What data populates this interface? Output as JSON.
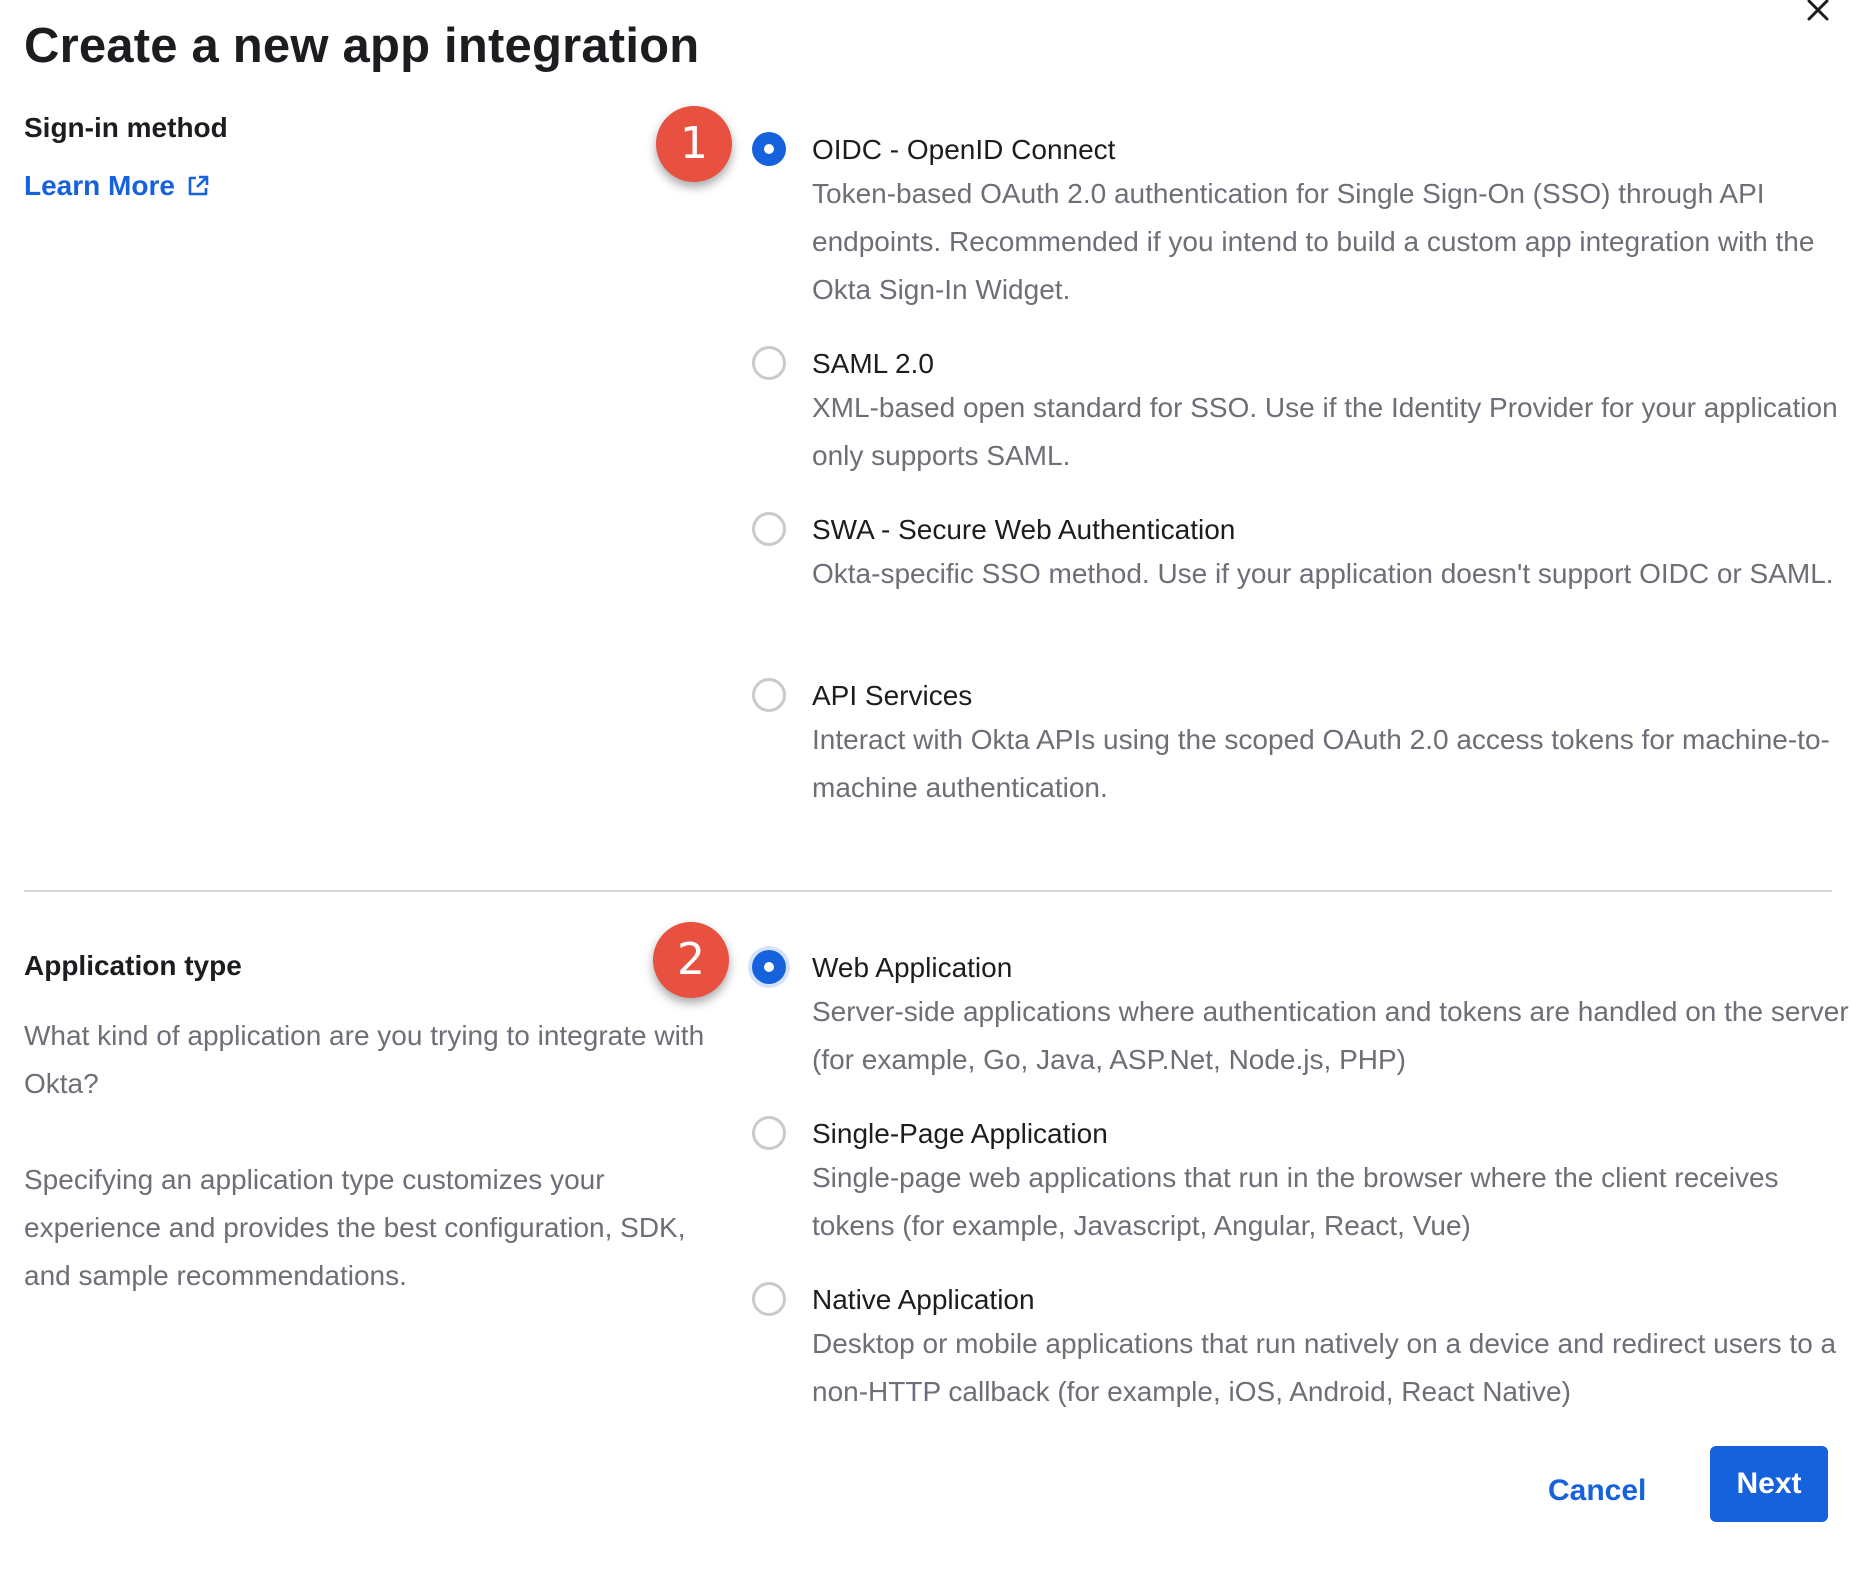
{
  "dialog": {
    "title": "Create a new app integration"
  },
  "sign_in": {
    "label": "Sign-in method",
    "learn_more": "Learn More",
    "badge": "1",
    "options": [
      {
        "label": "OIDC - OpenID Connect",
        "description": "Token-based OAuth 2.0 authentication for Single Sign-On (SSO) through API endpoints. Recommended if you intend to build a custom app integration with the Okta Sign-In Widget.",
        "checked": true
      },
      {
        "label": "SAML 2.0",
        "description": "XML-based open standard for SSO. Use if the Identity Provider for your application only supports SAML.",
        "checked": false
      },
      {
        "label": "SWA - Secure Web Authentication",
        "description": "Okta-specific SSO method. Use if your application doesn't support OIDC or SAML.",
        "checked": false
      },
      {
        "label": "API Services",
        "description": "Interact with Okta APIs using the scoped OAuth 2.0 access tokens for machine-to-machine authentication.",
        "checked": false
      }
    ]
  },
  "app_type": {
    "label": "Application type",
    "description_1": "What kind of application are you trying to integrate with Okta?",
    "description_2": "Specifying an application type customizes your experience and provides the best configuration, SDK, and sample recommendations.",
    "badge": "2",
    "options": [
      {
        "label": "Web Application",
        "description": "Server-side applications where authentication and tokens are handled on the server (for example, Go, Java, ASP.Net, Node.js, PHP)",
        "checked": true
      },
      {
        "label": "Single-Page Application",
        "description": "Single-page web applications that run in the browser where the client receives tokens (for example, Javascript, Angular, React, Vue)",
        "checked": false
      },
      {
        "label": "Native Application",
        "description": "Desktop or mobile applications that run natively on a device and redirect users to a non-HTTP callback (for example, iOS, Android, React Native)",
        "checked": false
      }
    ]
  },
  "footer": {
    "cancel": "Cancel",
    "next": "Next"
  },
  "colors": {
    "accent": "#1662dd",
    "badge": "#e8503f",
    "muted_text": "#6e6e78"
  },
  "icons": {
    "close": "close-icon",
    "external_link": "external-link-icon"
  }
}
